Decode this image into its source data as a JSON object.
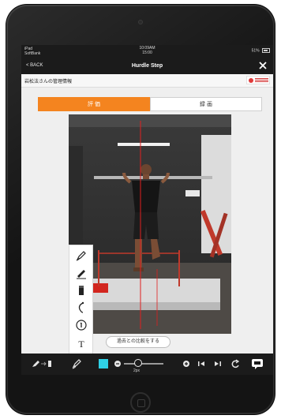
{
  "status_bar": {
    "carrier": "iPad",
    "network": "SoftBank",
    "time": "10:09AM",
    "time_secondary": "15:00",
    "battery": "51%"
  },
  "nav": {
    "back_label": "< BACK",
    "title": "Hurdle Step"
  },
  "info": {
    "user_name": "岩松法さんの管理情報"
  },
  "tabs": [
    {
      "label": "評 価",
      "active": true
    },
    {
      "label": "録 画",
      "active": false
    }
  ],
  "compare_button": "過去との比較をする",
  "tools": [
    "pen-icon",
    "line-icon",
    "eraser-icon",
    "curve-icon",
    "number-stamp-icon",
    "text-tool"
  ],
  "text_tool_label": "T",
  "toolbar": {
    "stroke_width": "2px",
    "selected_color": "#2fd1e6"
  },
  "colors": {
    "accent": "#f4841f",
    "toolbar_bg": "#1b1b1b",
    "guide_line": "#e11f1f"
  }
}
